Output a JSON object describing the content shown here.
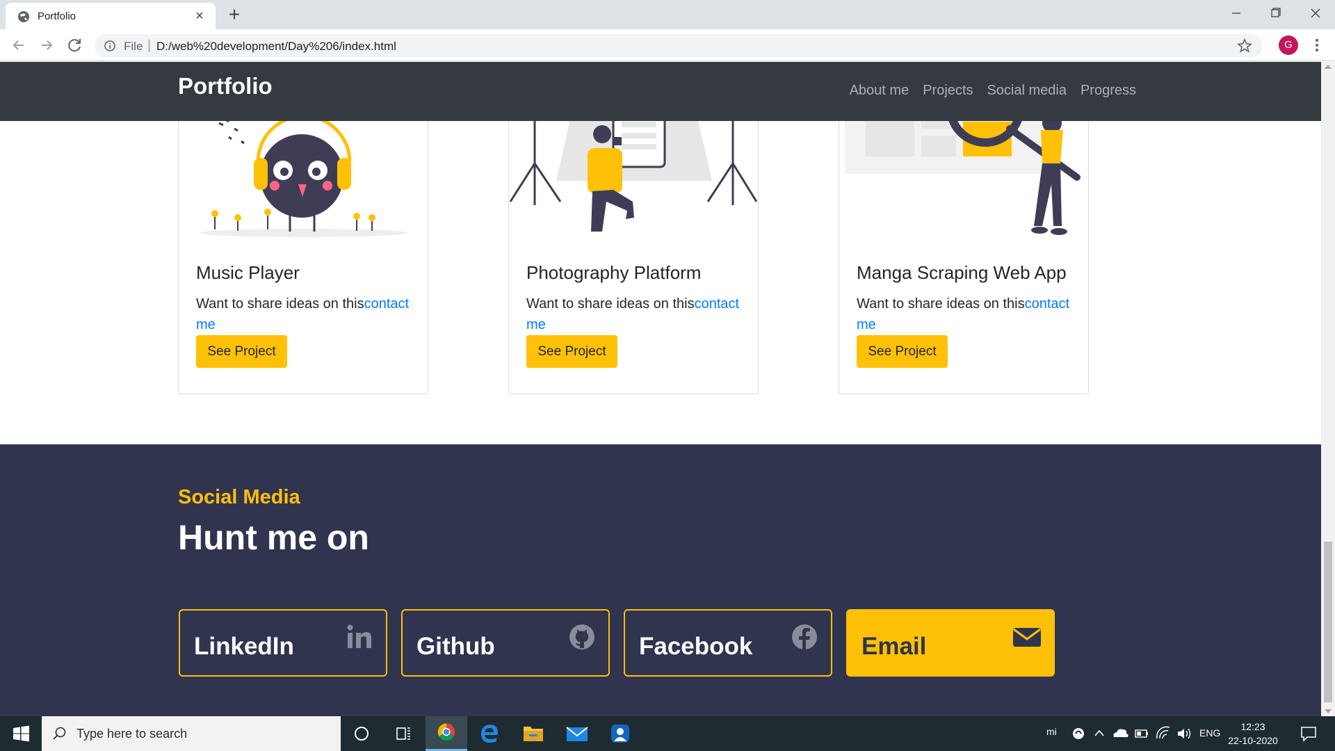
{
  "browser": {
    "tab_title": "Portfolio",
    "url_scheme_label": "File",
    "url_separator": "|",
    "url": "D:/web%20development/Day%206/index.html",
    "profile_initial": "G"
  },
  "navbar": {
    "brand": "Portfolio",
    "links": [
      "About me",
      "Projects",
      "Social media",
      "Progress"
    ]
  },
  "projects": [
    {
      "title": "Music Player",
      "text": "Want to share ideas on this",
      "link": "contact me",
      "button": "See Project",
      "illustration": "music-bird-illustration"
    },
    {
      "title": "Photography Platform",
      "text": "Want to share ideas on this",
      "link": "contact me",
      "button": "See Project",
      "illustration": "photographer-illustration"
    },
    {
      "title": "Manga Scraping Web App",
      "text": "Want to share ideas on this",
      "link": "contact me",
      "button": "See Project",
      "illustration": "search-magnifier-illustration"
    }
  ],
  "social": {
    "kicker": "Social Media",
    "heading": "Hunt me on",
    "cards": [
      {
        "label": "LinkedIn",
        "icon": "linkedin-icon"
      },
      {
        "label": "Github",
        "icon": "github-icon"
      },
      {
        "label": "Facebook",
        "icon": "facebook-icon"
      },
      {
        "label": "Email",
        "icon": "email-icon"
      }
    ]
  },
  "taskbar": {
    "search_placeholder": "Type here to search",
    "tray_lang": "ENG",
    "tray_mi": "mi",
    "time": "12:23",
    "date": "22-10-2020"
  },
  "colors": {
    "navbar_bg": "#343a40",
    "accent": "#ffc107",
    "social_bg": "#31344f",
    "link": "#007bff"
  }
}
